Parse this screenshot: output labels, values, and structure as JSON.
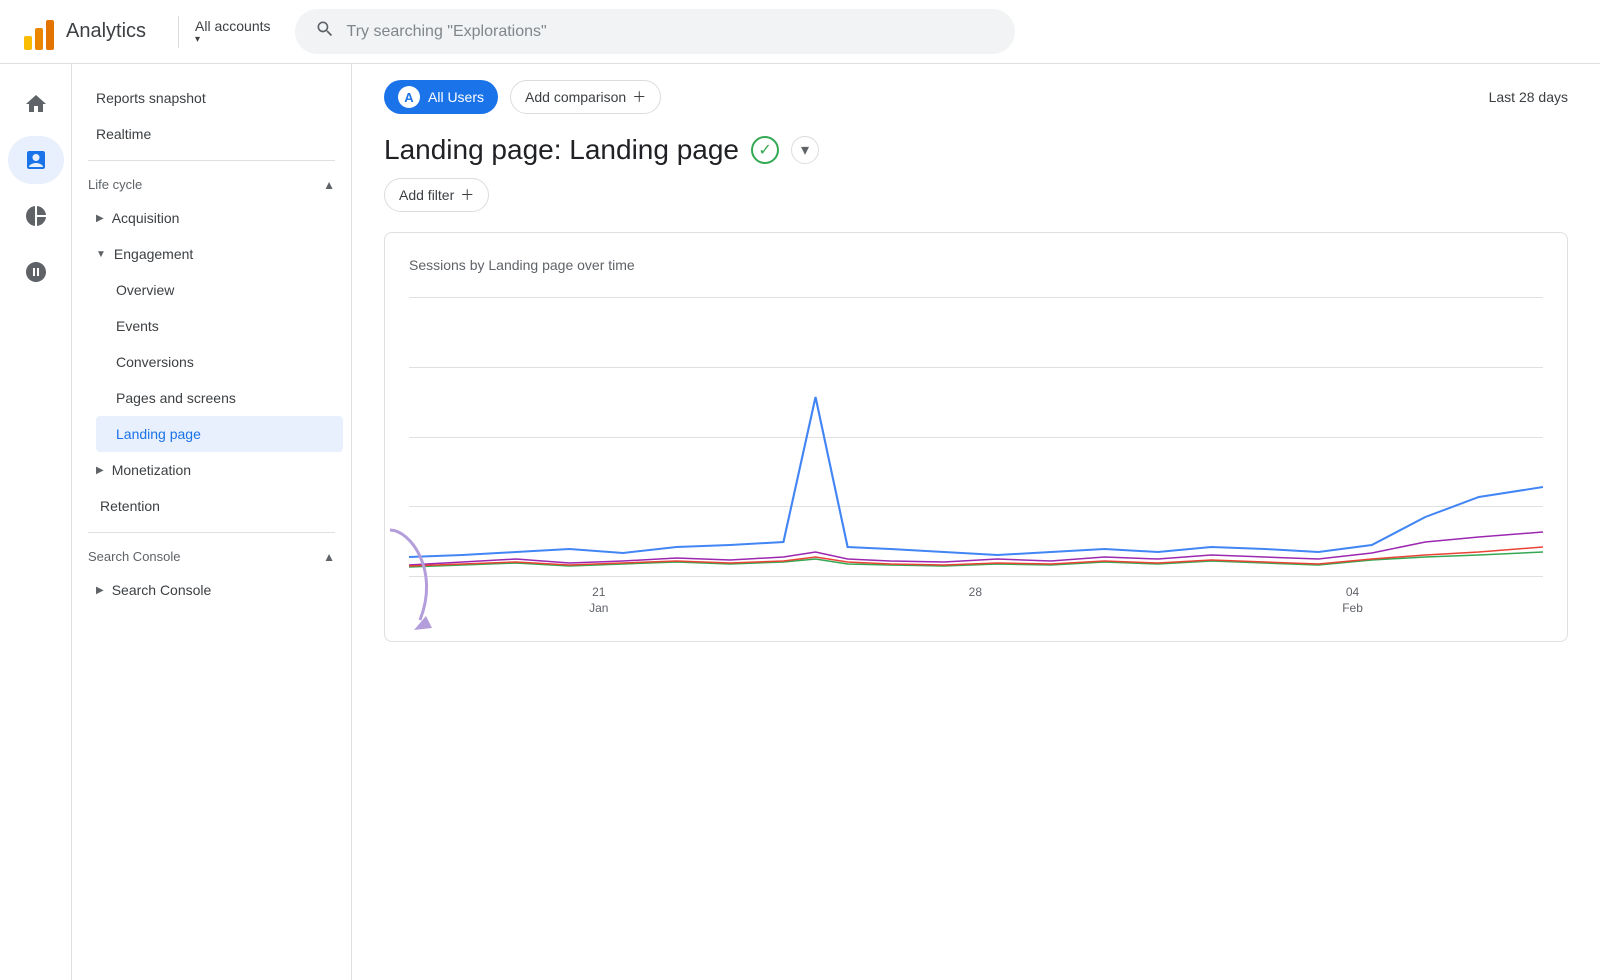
{
  "header": {
    "logo_text": "Analytics",
    "all_accounts_label": "All accounts",
    "search_placeholder": "Try searching \"Explorations\""
  },
  "nav_icons": [
    {
      "name": "home-icon",
      "label": "Home",
      "active": false
    },
    {
      "name": "dashboard-icon",
      "label": "Dashboard",
      "active": true
    },
    {
      "name": "explore-icon",
      "label": "Explore",
      "active": false
    },
    {
      "name": "advertising-icon",
      "label": "Advertising",
      "active": false
    }
  ],
  "sidebar": {
    "top_items": [
      {
        "label": "Reports snapshot",
        "name": "reports-snapshot"
      },
      {
        "label": "Realtime",
        "name": "realtime"
      }
    ],
    "sections": [
      {
        "name": "lifecycle",
        "label": "Life cycle",
        "expanded": true,
        "items": [
          {
            "name": "acquisition",
            "label": "Acquisition",
            "expanded": false,
            "children": []
          },
          {
            "name": "engagement",
            "label": "Engagement",
            "expanded": true,
            "children": [
              {
                "label": "Overview",
                "name": "overview"
              },
              {
                "label": "Events",
                "name": "events"
              },
              {
                "label": "Conversions",
                "name": "conversions"
              },
              {
                "label": "Pages and screens",
                "name": "pages-and-screens"
              },
              {
                "label": "Landing page",
                "name": "landing-page",
                "active": true
              }
            ]
          },
          {
            "name": "monetization",
            "label": "Monetization",
            "expanded": false,
            "children": []
          },
          {
            "name": "retention",
            "label": "Retention",
            "expanded": false,
            "children": []
          }
        ]
      },
      {
        "name": "search-console-section",
        "label": "Search Console",
        "expanded": true,
        "items": [
          {
            "name": "search-console-item",
            "label": "Search Console",
            "expanded": false,
            "children": []
          }
        ]
      }
    ]
  },
  "content": {
    "all_users_label": "All Users",
    "add_comparison_label": "Add comparison",
    "date_range": "Last 28 days",
    "page_title": "Landing page: Landing page",
    "add_filter_label": "Add filter",
    "chart_title": "Sessions by Landing page over time",
    "x_labels": [
      {
        "date": "21",
        "month": "Jan"
      },
      {
        "date": "28",
        "month": ""
      },
      {
        "date": "04",
        "month": "Feb"
      }
    ]
  }
}
